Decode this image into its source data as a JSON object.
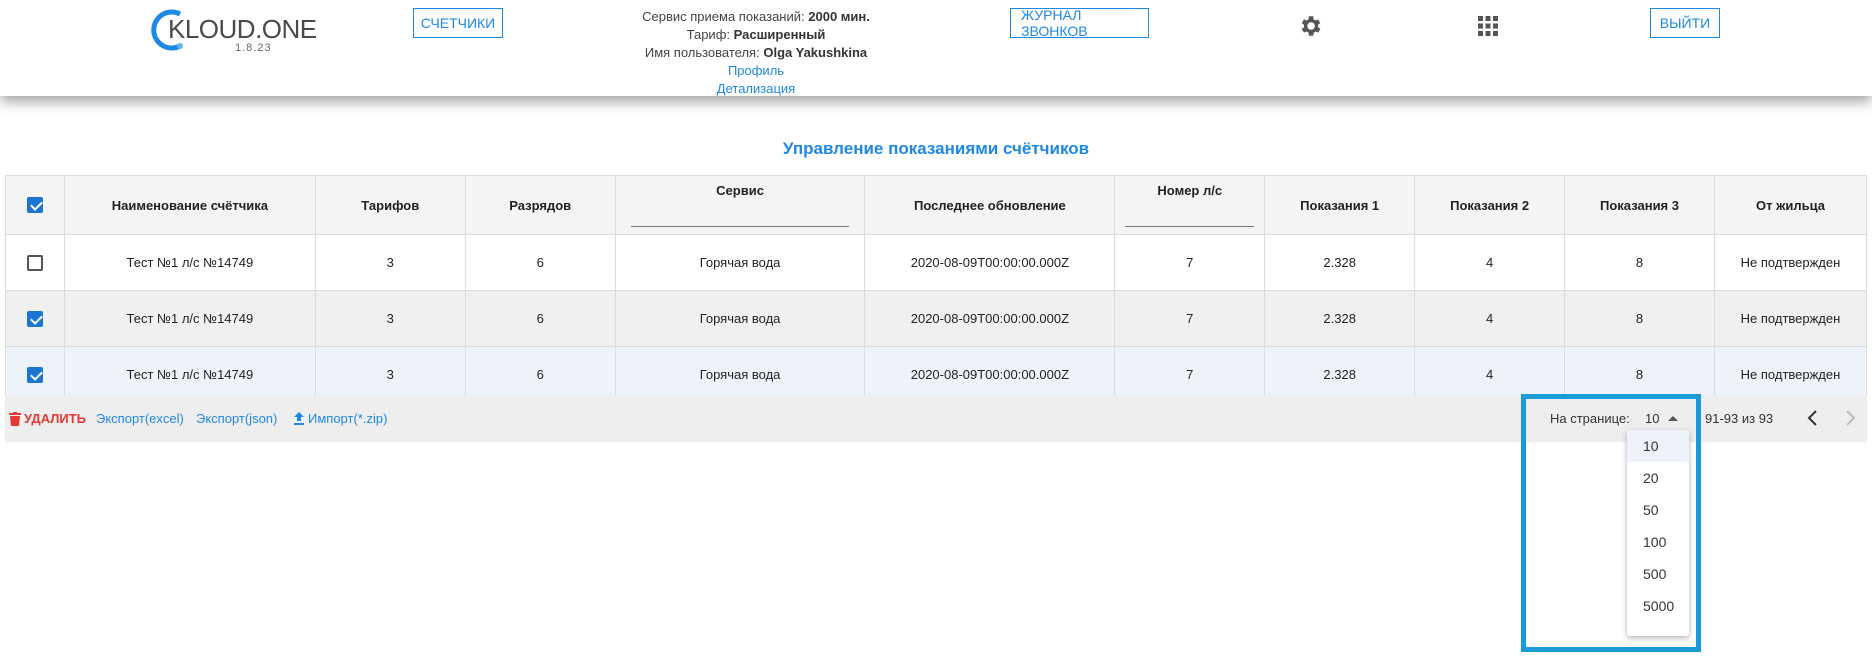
{
  "header": {
    "logo_text": "KLOUD.ONE",
    "logo_version": "1.8.23",
    "counters_button": "СЧЕТЧИКИ",
    "journal_button": "ЖУРНАЛ ЗВОНКОВ",
    "logout_button": "ВЫЙТИ",
    "service_label": "Сервис приема показаний:",
    "service_value": "2000 мин.",
    "tariff_label": "Тариф:",
    "tariff_value": "Расширенный",
    "user_label": "Имя пользователя:",
    "user_value": "Olga Yakushkina",
    "profile_link": "Профиль",
    "details_link": "Детализация",
    "icons": [
      "gear-icon",
      "apps-grid-icon"
    ]
  },
  "page_title": "Управление показаниями счётчиков",
  "table": {
    "columns": [
      "Наименование счётчика",
      "Тарифов",
      "Разрядов",
      "Сервис",
      "Последнее обновление",
      "Номер л/с",
      "Показания 1",
      "Показания 2",
      "Показания 3",
      "От жильца"
    ],
    "select_all_checked": true,
    "rows": [
      {
        "checked": false,
        "cells": [
          "Тест №1 л/с №14749",
          "3",
          "6",
          "Горячая вода",
          "2020-08-09T00:00:00.000Z",
          "7",
          "2.328",
          "4",
          "8",
          "Не подтвержден"
        ]
      },
      {
        "checked": true,
        "cells": [
          "Тест №1 л/с №14749",
          "3",
          "6",
          "Горячая вода",
          "2020-08-09T00:00:00.000Z",
          "7",
          "2.328",
          "4",
          "8",
          "Не подтвержден"
        ]
      },
      {
        "checked": true,
        "cells": [
          "Тест №1 л/с №14749",
          "3",
          "6",
          "Горячая вода",
          "2020-08-09T00:00:00.000Z",
          "7",
          "2.328",
          "4",
          "8",
          "Не подтвержден"
        ]
      }
    ]
  },
  "footer": {
    "delete_label": "УДАЛИТЬ",
    "export_excel": "Экспорт(excel)",
    "export_json": "Экспорт(json)",
    "import_zip": "Импорт(*.zip)",
    "per_page_label": "На странице:",
    "per_page_value": "10",
    "range_text": "91-93 из 93"
  },
  "per_page_options": [
    "10",
    "20",
    "50",
    "100",
    "500",
    "5000"
  ],
  "colors": {
    "accent": "#1e88e5",
    "danger": "#e53935",
    "highlight": "#1a9ad6"
  }
}
